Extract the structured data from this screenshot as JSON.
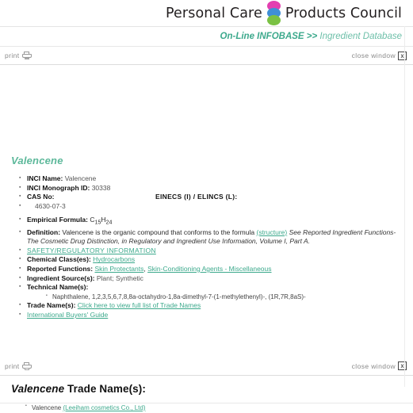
{
  "header": {
    "brand_left": "Personal Care",
    "brand_right": "Products Council",
    "logo_colors": {
      "top": "#e33fb0",
      "middle": "#3f8fd6",
      "bottom": "#7ac143"
    }
  },
  "nav": {
    "primary": "On-Line INFOBASE >> ",
    "secondary": "Ingredient Database",
    "accent_color": "#3ca98c"
  },
  "toolbar_top": {
    "print_label": "print",
    "close_label": "close window",
    "close_glyph": "x"
  },
  "toolbar_bottom": {
    "print_label": "print",
    "close_label": "close window",
    "close_glyph": "x"
  },
  "ingredient": {
    "title": "Valencene",
    "inci_name_label": "INCI Name:",
    "inci_name_value": "Valencene",
    "monograph_label": "INCI Monograph ID:",
    "monograph_value": "30338",
    "cas_label": "CAS No:",
    "cas_value": "4630-07-3",
    "einecs_label": "EINECS (I) / ELINCS (L):",
    "einecs_value": "",
    "formula_label": "Empirical Formula:",
    "formula_value": "C15H24",
    "formula_base1": "C",
    "formula_sub1": "15",
    "formula_base2": "H",
    "formula_sub2": "24",
    "definition_label": "Definition:",
    "definition_text": "Valencene is the organic compound that conforms to the formula",
    "definition_structure_link": "(structure)",
    "definition_tail": "See Reported Ingredient Functions-The Cosmetic Drug Distinction, in Regulatory and Ingredient Use Information, Volume I, Part A.",
    "safety_link": "SAFETY/REGULATORY INFORMATION",
    "chemical_class_label": "Chemical Class(es):",
    "chemical_class_link": "Hydrocarbons",
    "reported_functions_label": "Reported Functions:",
    "reported_function_1": "Skin Protectants",
    "reported_function_2": "Skin-Conditioning Agents - Miscellaneous",
    "ingredient_source_label": "Ingredient Source(s):",
    "ingredient_source_value": "Plant; Synthetic",
    "technical_name_label": "Technical Name(s):",
    "technical_name_value": "Naphthalene, 1,2,3,5,6,7,8,8a-octahydro-1,8a-dimethyl-7-(1-methylethenyl)-, (1R,7R,8aS)-",
    "trade_name_label": "Trade Name(s):",
    "trade_name_link": "Click here to view full list of Trade Names",
    "buyers_guide_link": "International Buyers' Guide"
  },
  "trade_section": {
    "title_em": "Valencene",
    "title_rest": " Trade Name(s):",
    "entry_name": "Valencene ",
    "entry_company": "(Leeiham cosmetics Co., Ltd)"
  }
}
